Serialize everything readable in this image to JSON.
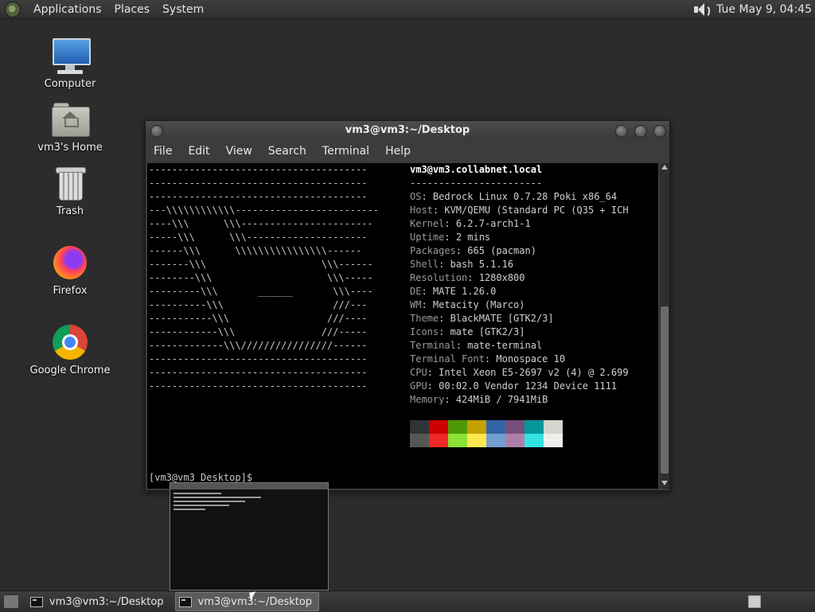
{
  "top_panel": {
    "menus": [
      "Applications",
      "Places",
      "System"
    ],
    "clock": "Tue May  9, 04:45"
  },
  "desktop_icons": [
    {
      "label": "Computer",
      "icon": "computer-icon"
    },
    {
      "label": "vm3's Home",
      "icon": "home-folder-icon"
    },
    {
      "label": "Trash",
      "icon": "trash-icon"
    },
    {
      "label": "Firefox",
      "icon": "firefox-icon"
    },
    {
      "label": "Google Chrome",
      "icon": "chrome-icon"
    }
  ],
  "window": {
    "title": "vm3@vm3:~/Desktop",
    "menu": [
      "File",
      "Edit",
      "View",
      "Search",
      "Terminal",
      "Help"
    ]
  },
  "terminal": {
    "logo_lines": [
      "--------------------------------------",
      "--------------------------------------",
      "--------------------------------------",
      "---\\\\\\\\\\\\\\\\\\\\\\\\-------------------------",
      "----\\\\\\      \\\\\\-----------------------",
      "-----\\\\\\      \\\\\\---------------------",
      "------\\\\\\      \\\\\\\\\\\\\\\\\\\\\\\\\\\\\\\\------",
      "-------\\\\\\                    \\\\\\------",
      "--------\\\\\\                    \\\\\\-----",
      "---------\\\\\\       ______       \\\\\\----",
      "----------\\\\\\                   ///---",
      "-----------\\\\\\                 ///----",
      "------------\\\\\\               ///-----",
      "-------------\\\\\\////////////////------",
      "--------------------------------------",
      "--------------------------------------",
      "--------------------------------------"
    ],
    "host": "vm3@vm3.collabnet.local",
    "separator": "-----------------------",
    "info": [
      {
        "key": "OS",
        "value": "Bedrock Linux 0.7.28 Poki x86_64"
      },
      {
        "key": "Host",
        "value": "KVM/QEMU (Standard PC (Q35 + ICH"
      },
      {
        "key": "Kernel",
        "value": "6.2.7-arch1-1"
      },
      {
        "key": "Uptime",
        "value": "2 mins"
      },
      {
        "key": "Packages",
        "value": "665 (pacman)"
      },
      {
        "key": "Shell",
        "value": "bash 5.1.16"
      },
      {
        "key": "Resolution",
        "value": "1280x800"
      },
      {
        "key": "DE",
        "value": "MATE 1.26.0"
      },
      {
        "key": "WM",
        "value": "Metacity (Marco)"
      },
      {
        "key": "Theme",
        "value": "BlackMATE [GTK2/3]"
      },
      {
        "key": "Icons",
        "value": "mate [GTK2/3]"
      },
      {
        "key": "Terminal",
        "value": "mate-terminal"
      },
      {
        "key": "Terminal Font",
        "value": "Monospace 10"
      },
      {
        "key": "CPU",
        "value": "Intel Xeon E5-2697 v2 (4) @ 2.699"
      },
      {
        "key": "GPU",
        "value": "00:02.0 Vendor 1234 Device 1111"
      },
      {
        "key": "Memory",
        "value": "424MiB / 7941MiB"
      }
    ],
    "palette_dark": [
      "#2e3436",
      "#cc0000",
      "#4e9a06",
      "#c4a000",
      "#3465a4",
      "#75507b",
      "#06989a",
      "#d3d7cf"
    ],
    "palette_bright": [
      "#555753",
      "#ef2929",
      "#8ae234",
      "#fce94f",
      "#729fcf",
      "#ad7fa8",
      "#34e2e2",
      "#eeeeec"
    ],
    "prompt": "[vm3@vm3 Desktop]$ "
  },
  "taskbar": {
    "tasks": [
      {
        "label": "vm3@vm3:~/Desktop",
        "active": false
      },
      {
        "label": "vm3@vm3:~/Desktop",
        "active": true
      }
    ]
  }
}
